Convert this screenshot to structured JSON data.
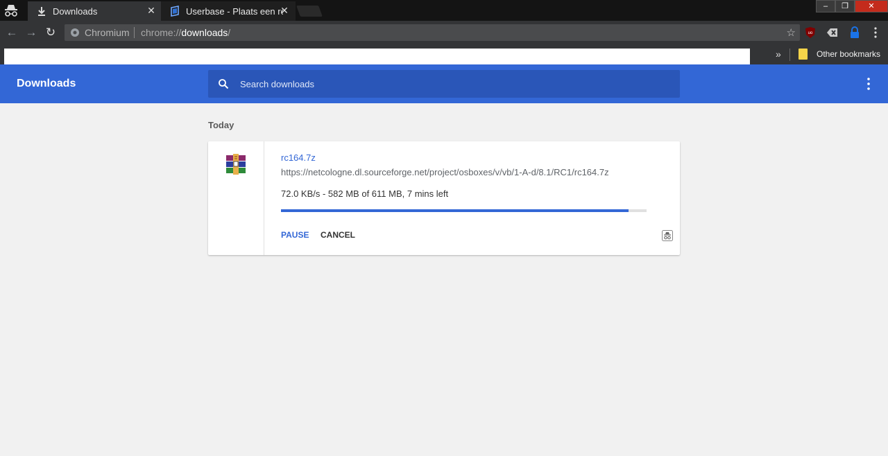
{
  "tabs": [
    {
      "title": "Downloads",
      "icon": "download-icon",
      "active": true
    },
    {
      "title": "Userbase - Plaats een rea",
      "icon": "userbase-favicon-icon",
      "active": false
    }
  ],
  "window_controls": {
    "minimize": "‒",
    "maximize": "❐",
    "close": "✕"
  },
  "toolbar": {
    "site_label": "Chromium",
    "url_prefix": "chrome://",
    "url_host": "downloads",
    "url_suffix": "/"
  },
  "bookmarks_bar": {
    "overflow": "»",
    "other_bookmarks": "Other bookmarks"
  },
  "header": {
    "title": "Downloads",
    "search_placeholder": "Search downloads"
  },
  "section": {
    "date": "Today"
  },
  "download": {
    "file_name": "rc164.7z",
    "url": "https://netcologne.dl.sourceforge.net/project/osboxes/v/vb/1-A-d/8.1/RC1/rc164.7z",
    "status": "72.0 KB/s - 582 MB of 611 MB, 7 mins left",
    "progress_percent": 95,
    "pause_label": "PAUSE",
    "cancel_label": "CANCEL"
  },
  "colors": {
    "accent": "#3367d6",
    "header": "#3367d6",
    "search_bg": "#2a56b8"
  }
}
